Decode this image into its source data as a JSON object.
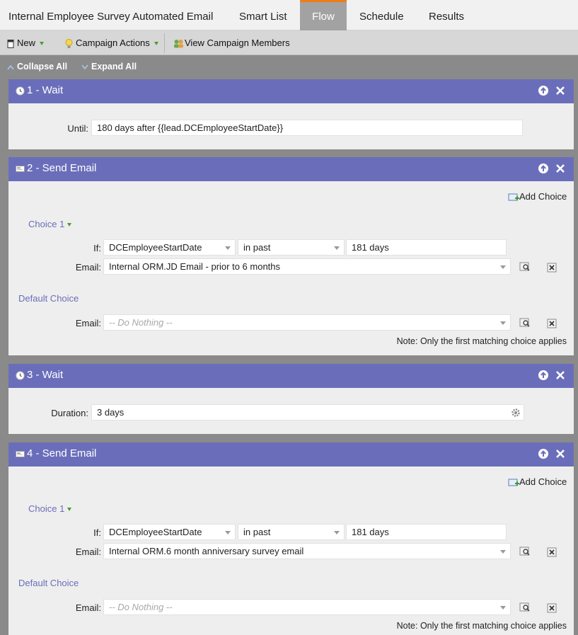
{
  "tabs": {
    "campaign_name": "Internal Employee Survey Automated Email",
    "smart_list": "Smart List",
    "flow": "Flow",
    "schedule": "Schedule",
    "results": "Results"
  },
  "toolbar": {
    "new": "New",
    "campaign_actions": "Campaign Actions",
    "view_members": "View Campaign Members"
  },
  "controls": {
    "collapse_all": "Collapse All",
    "expand_all": "Expand All"
  },
  "steps": [
    {
      "title": "1 - Wait",
      "until_label": "Until:",
      "until_value": "180 days after {{lead.DCEmployeeStartDate}}"
    },
    {
      "title": "2 - Send Email",
      "add_choice": "Add Choice",
      "choice_label": "Choice 1",
      "if_label": "If:",
      "if_field": "DCEmployeeStartDate",
      "if_operator": "in past",
      "if_value": "181 days",
      "email_label": "Email:",
      "email_value": "Internal ORM.JD Email - prior to 6 months",
      "default_label": "Default Choice",
      "default_email_label": "Email:",
      "default_email_placeholder": "-- Do Nothing --",
      "note": "Note: Only the first matching choice applies"
    },
    {
      "title": "3 - Wait",
      "duration_label": "Duration:",
      "duration_value": "3 days"
    },
    {
      "title": "4 - Send Email",
      "add_choice": "Add Choice",
      "choice_label": "Choice 1",
      "if_label": "If:",
      "if_field": "DCEmployeeStartDate",
      "if_operator": "in past",
      "if_value": "181 days",
      "email_label": "Email:",
      "email_value": "Internal ORM.6 month anniversary survey email",
      "default_label": "Default Choice",
      "default_email_label": "Email:",
      "default_email_placeholder": "-- Do Nothing --",
      "note": "Note: Only the first matching choice applies"
    }
  ],
  "colors": {
    "step_header": "#6a6eba",
    "active_tab_accent": "#f07c1a",
    "caret_green": "#4a9c2f"
  }
}
